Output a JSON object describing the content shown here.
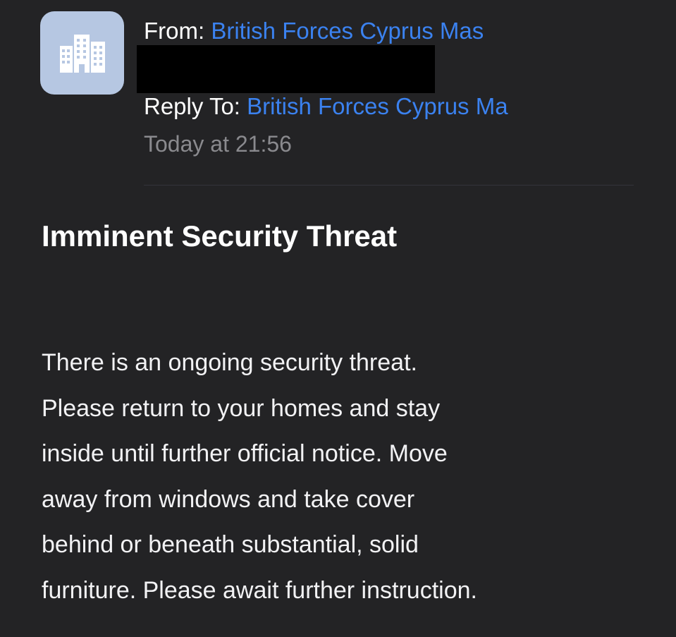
{
  "header": {
    "avatar_icon": "building-icon",
    "from_label": "From:",
    "from_address": "British Forces Cyprus Mas",
    "reply_to_label": "Reply To:",
    "reply_to_address": "British Forces Cyprus Ma",
    "date": "Today at 21:56"
  },
  "message": {
    "subject": "Imminent Security Threat",
    "body_lines": [
      "There is an ongoing security threat.",
      "Please return to your homes and stay",
      "inside until further official notice. Move",
      "away from windows and take cover",
      "behind or beneath substantial, solid",
      "furniture. Please await further instruction."
    ]
  },
  "colors": {
    "background": "#232325",
    "link_blue": "#3b82f0",
    "avatar_bg": "#b6c7e2",
    "date_gray": "#8a8a8e"
  }
}
